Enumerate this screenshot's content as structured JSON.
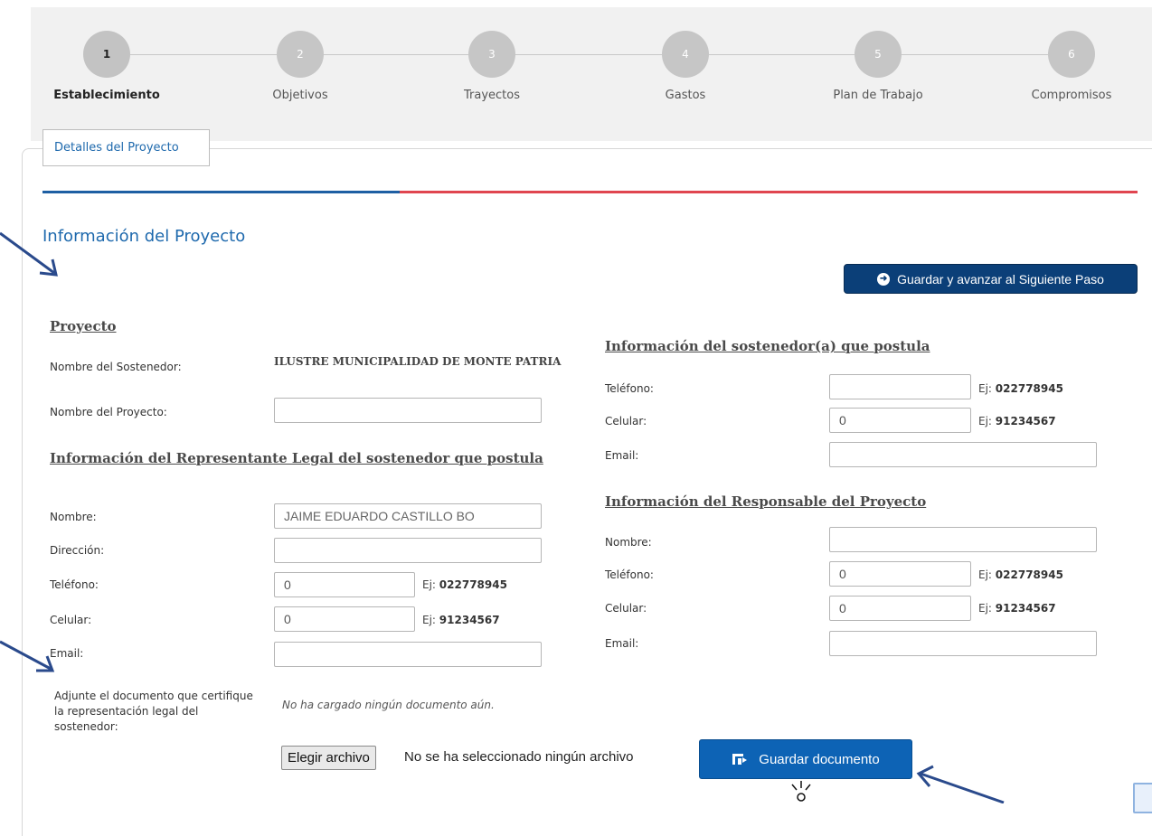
{
  "stepper": {
    "steps": [
      {
        "num": "1",
        "label": "Establecimiento"
      },
      {
        "num": "2",
        "label": "Objetivos"
      },
      {
        "num": "3",
        "label": "Trayectos"
      },
      {
        "num": "4",
        "label": "Gastos"
      },
      {
        "num": "5",
        "label": "Plan de Trabajo"
      },
      {
        "num": "6",
        "label": "Compromisos"
      }
    ],
    "active_step": 1
  },
  "tabs": {
    "active": "Detalles del Proyecto"
  },
  "section_title": "Información del Proyecto",
  "next_button": {
    "label": "Guardar y avanzar al Siguiente Paso",
    "icon": "arrow-circle-right-icon"
  },
  "proyecto": {
    "heading": "Proyecto",
    "sostenedor_label": "Nombre del Sostenedor:",
    "sostenedor_value": "ILUSTRE MUNICIPALIDAD DE MONTE PATRIA",
    "nombre_label": "Nombre del Proyecto:",
    "nombre_value": ""
  },
  "representante": {
    "heading": "Información del Representante Legal del sostenedor que postula",
    "nombre_label": "Nombre:",
    "nombre_value": "JAIME EDUARDO CASTILLO BO",
    "direccion_label": "Dirección:",
    "direccion_value": "",
    "telefono_label": "Teléfono:",
    "telefono_value": "0",
    "telefono_hint_prefix": "Ej:",
    "telefono_hint_value": "022778945",
    "celular_label": "Celular:",
    "celular_value": "0",
    "celular_hint_prefix": "Ej:",
    "celular_hint_value": "91234567",
    "email_label": "Email:",
    "email_value": ""
  },
  "sostenedor_info": {
    "heading": "Información del sostenedor(a) que postula",
    "telefono_label": "Teléfono:",
    "telefono_value": "",
    "telefono_hint_prefix": "Ej:",
    "telefono_hint_value": "022778945",
    "celular_label": "Celular:",
    "celular_value": "0",
    "celular_hint_prefix": "Ej:",
    "celular_hint_value": "91234567",
    "email_label": "Email:",
    "email_value": ""
  },
  "responsable": {
    "heading": "Información del Responsable del Proyecto",
    "nombre_label": "Nombre:",
    "nombre_value": "",
    "telefono_label": "Teléfono:",
    "telefono_value": "0",
    "telefono_hint_prefix": "Ej:",
    "telefono_hint_value": "022778945",
    "celular_label": "Celular:",
    "celular_value": "0",
    "celular_hint_prefix": "Ej:",
    "celular_hint_value": "91234567",
    "email_label": "Email:",
    "email_value": ""
  },
  "attachment": {
    "label": "Adjunte el documento que certifique la representación legal del sostenedor:",
    "status_note": "No ha cargado ningún documento aún.",
    "file_button": "Elegir archivo",
    "file_status": "No se ha seleccionado ningún archivo",
    "save_button": "Guardar documento",
    "save_icon": "save-file-icon"
  },
  "colors": {
    "accent_blue": "#1e69ad",
    "dark_blue": "#0b3f78",
    "bar_red": "#e0454f",
    "annotation_arrow": "#2a4a8c"
  }
}
